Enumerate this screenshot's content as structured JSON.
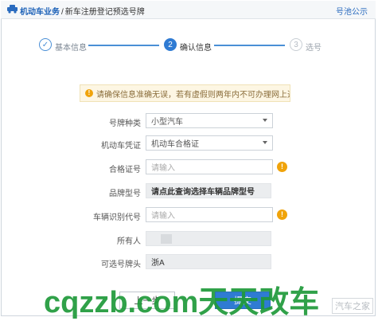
{
  "header": {
    "section": "机动车业务",
    "separator": "/",
    "current_page": "新车注册登记预选号牌",
    "notice_link": "号池公示"
  },
  "steps": [
    {
      "number": "✓",
      "label": "基本信息",
      "state": "done"
    },
    {
      "number": "2",
      "label": "确认信息",
      "state": "active"
    },
    {
      "number": "3",
      "label": "选号",
      "state": "pending"
    }
  ],
  "alert": {
    "text": "请确保信息准确无误，若有虚假则两年内不可办理网上选号业务"
  },
  "form": {
    "plate_type": {
      "label": "号牌种类",
      "value": "小型汽车"
    },
    "vehicle_cert": {
      "label": "机动车凭证",
      "value": "机动车合格证"
    },
    "cert_number": {
      "label": "合格证号",
      "placeholder": "请输入"
    },
    "brand_model": {
      "label": "品牌型号",
      "value": "请点此查询选择车辆品牌型号"
    },
    "vin": {
      "label": "车辆识别代号",
      "placeholder": "请输入"
    },
    "owner": {
      "label": "所有人",
      "value": ""
    },
    "plate_prefix": {
      "label": "可选号牌头",
      "value": "浙A"
    }
  },
  "buttons": {
    "prev": "上一步",
    "submit": "提交"
  },
  "watermark": "cqzzb.com天天改车",
  "corner_logo": "汽车之家",
  "colors": {
    "primary": "#2f7bd3",
    "warning": "#f0a30a",
    "alert_bg": "#fdf6e3",
    "watermark": "#1f9a3a"
  }
}
